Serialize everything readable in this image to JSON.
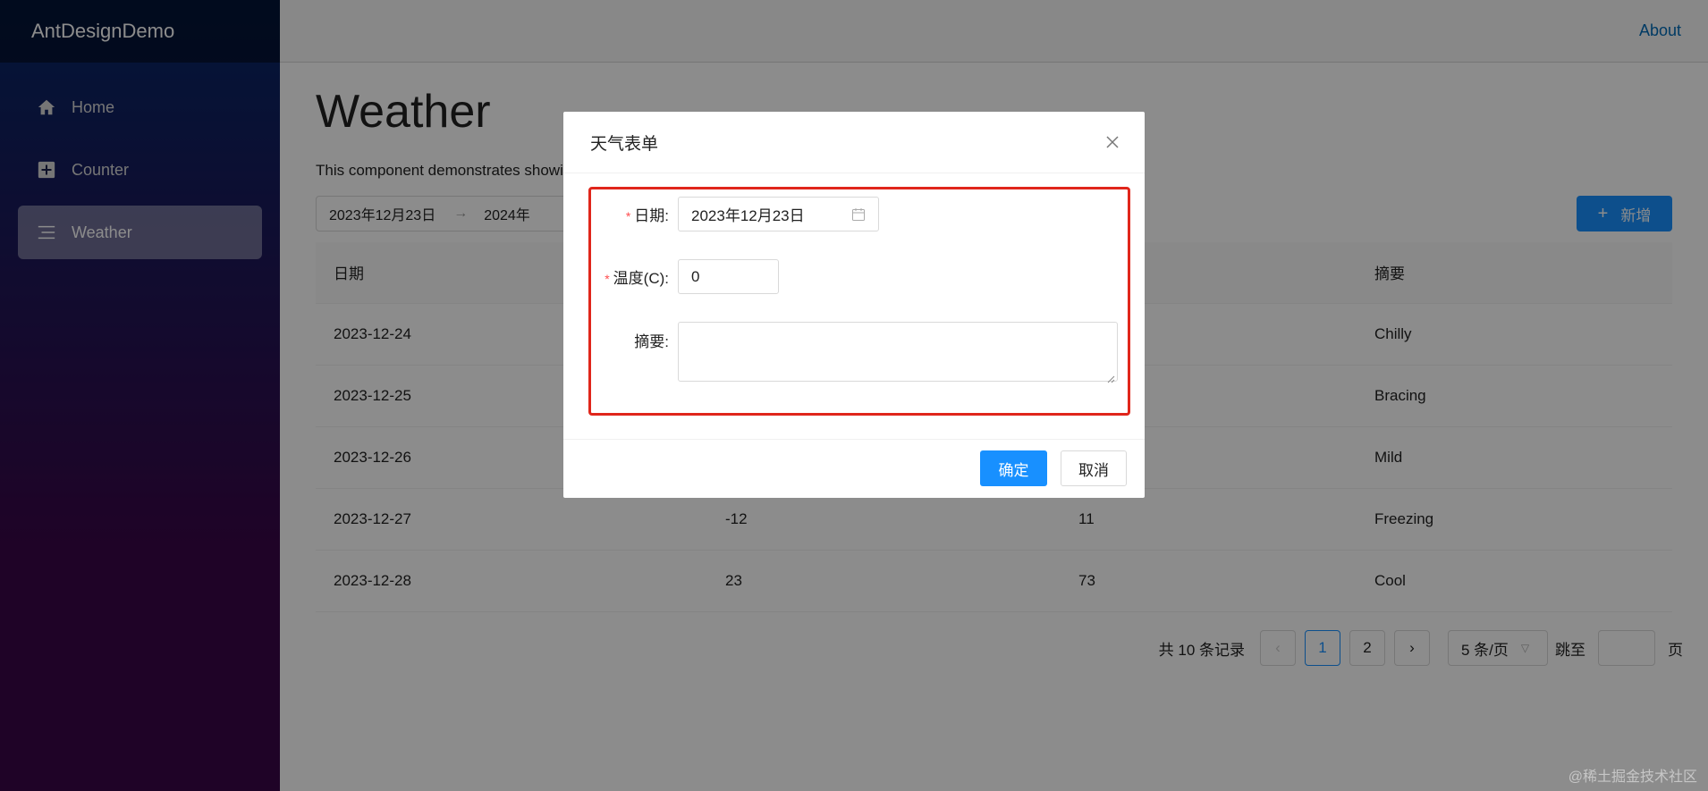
{
  "app": {
    "brand": "AntDesignDemo",
    "about": "About"
  },
  "sidebar": {
    "items": [
      {
        "label": "Home",
        "icon": "home-icon"
      },
      {
        "label": "Counter",
        "icon": "plus-square-icon"
      },
      {
        "label": "Weather",
        "icon": "list-icon",
        "active": true
      }
    ]
  },
  "page": {
    "title": "Weather",
    "description": "This component demonstrates showing data."
  },
  "toolbar": {
    "range_start": "2023年12月23日",
    "range_end": "2024年",
    "add_label": "新增"
  },
  "table": {
    "headers": [
      "日期",
      "",
      "",
      "摘要"
    ],
    "rows": [
      [
        "2023-12-24",
        "",
        "",
        "Chilly"
      ],
      [
        "2023-12-25",
        "",
        "",
        "Bracing"
      ],
      [
        "2023-12-26",
        "",
        "",
        "Mild"
      ],
      [
        "2023-12-27",
        "-12",
        "11",
        "Freezing"
      ],
      [
        "2023-12-28",
        "23",
        "73",
        "Cool"
      ]
    ]
  },
  "pagination": {
    "total": "共 10 条记录",
    "pages": [
      "1",
      "2"
    ],
    "current": "1",
    "page_size": "5 条/页",
    "jump_label": "跳至",
    "page_suffix": "页"
  },
  "modal": {
    "title": "天气表单",
    "fields": {
      "date_label": "日期:",
      "date_value": "2023年12月23日",
      "temp_label": "温度(C):",
      "temp_value": "0",
      "summary_label": "摘要:"
    },
    "ok_label": "确定",
    "cancel_label": "取消"
  },
  "watermark": "@稀土掘金技术社区",
  "colors": {
    "primary": "#1890ff",
    "highlight": "#e0261b",
    "required": "#ff4d4f"
  }
}
